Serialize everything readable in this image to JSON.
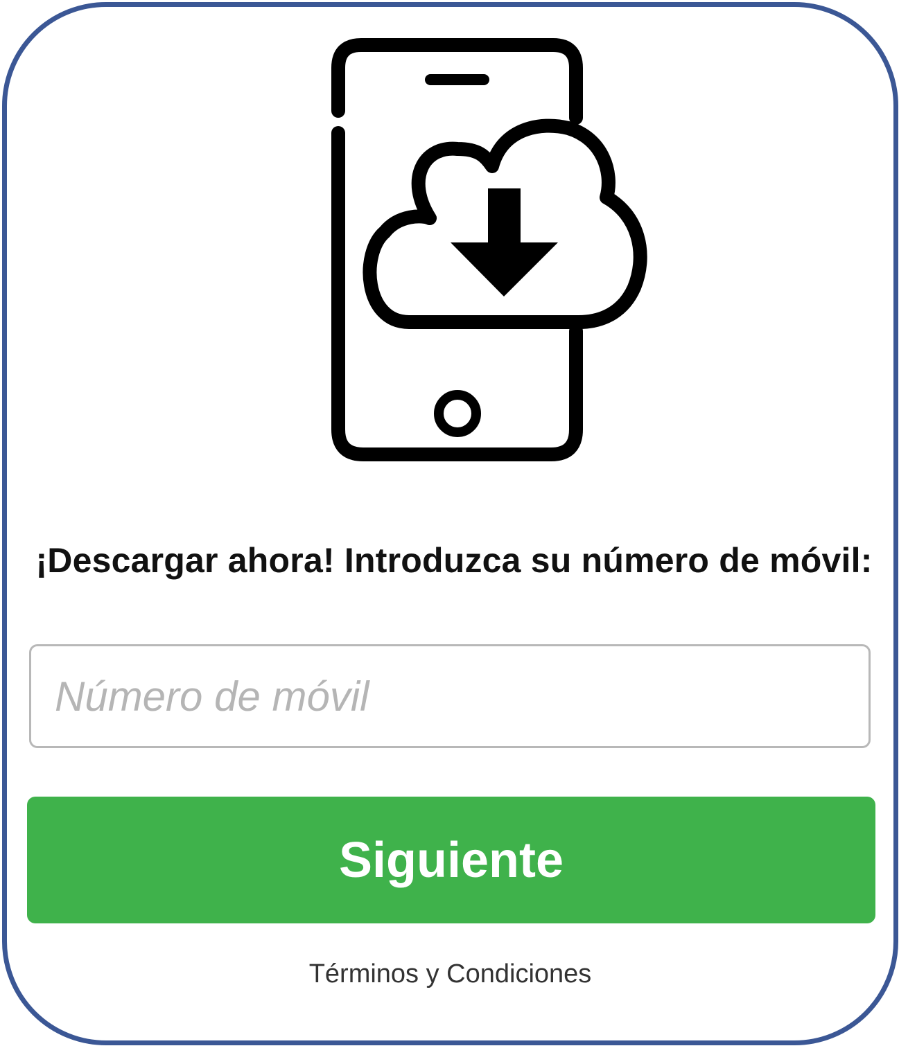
{
  "form": {
    "prompt": "¡Descargar ahora! Introduzca su número de móvil:",
    "phone_placeholder": "Número de móvil",
    "phone_value": "",
    "next_label": "Siguiente",
    "terms_label": "Términos y Condiciones"
  },
  "icons": {
    "hero": "phone-cloud-download-icon"
  },
  "colors": {
    "frame_border": "#3b5795",
    "button_bg": "#3fb24b",
    "button_text": "#ffffff",
    "input_border": "#b8b8b8",
    "placeholder": "#b5b5b5"
  }
}
